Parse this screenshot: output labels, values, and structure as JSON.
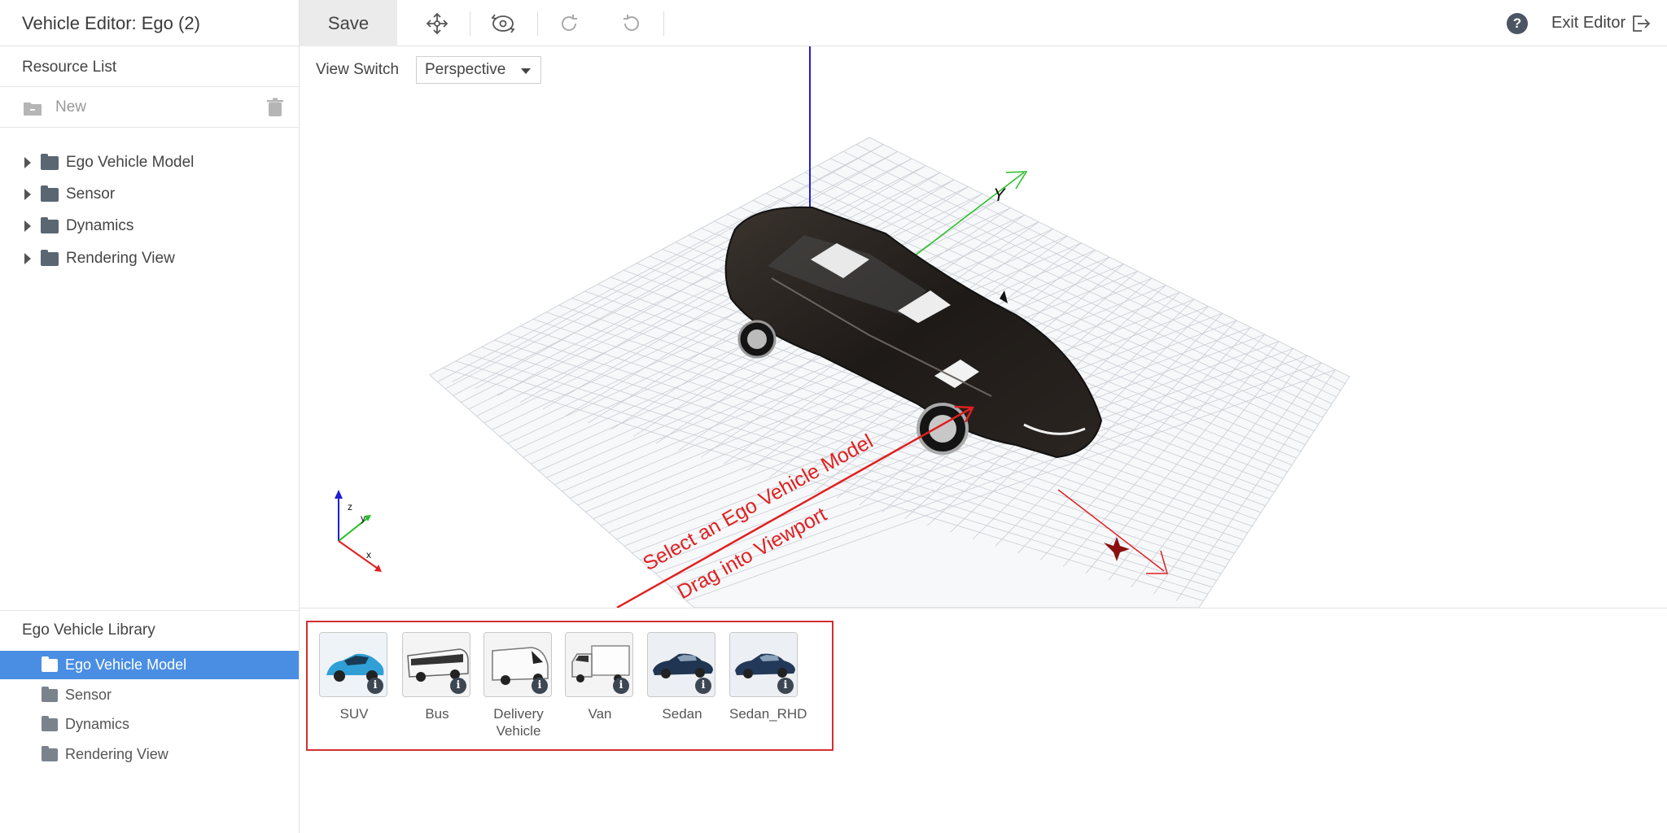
{
  "app": {
    "title": "Vehicle Editor: Ego (2)",
    "save_label": "Save",
    "help_glyph": "?",
    "exit_label": "Exit Editor",
    "toolbar_icons": [
      "move-icon",
      "orbit-icon",
      "redo-icon",
      "undo-icon"
    ]
  },
  "resources": {
    "heading": "Resource List",
    "new_label": "New",
    "items": [
      {
        "label": "Ego Vehicle Model"
      },
      {
        "label": "Sensor"
      },
      {
        "label": "Dynamics"
      },
      {
        "label": "Rendering View"
      }
    ]
  },
  "library": {
    "heading": "Ego Vehicle Library",
    "selected": "Ego Vehicle Model",
    "items": [
      {
        "label": "Ego Vehicle Model"
      },
      {
        "label": "Sensor"
      },
      {
        "label": "Dynamics"
      },
      {
        "label": "Rendering View"
      }
    ],
    "vehicles": [
      {
        "label": "SUV",
        "color": "#2f9fd6"
      },
      {
        "label": "Bus",
        "color": "#eeeeee"
      },
      {
        "label": "Delivery Vehicle",
        "color": "#f5f5f5"
      },
      {
        "label": "Van",
        "color": "#f7f7f7"
      },
      {
        "label": "Sedan",
        "color": "#1f3552"
      },
      {
        "label": "Sedan_RHD",
        "color": "#23395a"
      }
    ]
  },
  "viewport": {
    "view_switch_label": "View Switch",
    "view_mode": "Perspective",
    "axis_y_label": "Y",
    "gizmo_labels": {
      "z": "z",
      "y": "y",
      "x": "x"
    },
    "hint_line1": "Select an Ego Vehicle Model",
    "hint_line2": "Drag into Viewport",
    "colors": {
      "x_axis": "#e02020",
      "y_axis": "#22c022",
      "z_axis": "#1f1fd0",
      "hint": "#e02020",
      "car_body": "#2a2420"
    }
  }
}
